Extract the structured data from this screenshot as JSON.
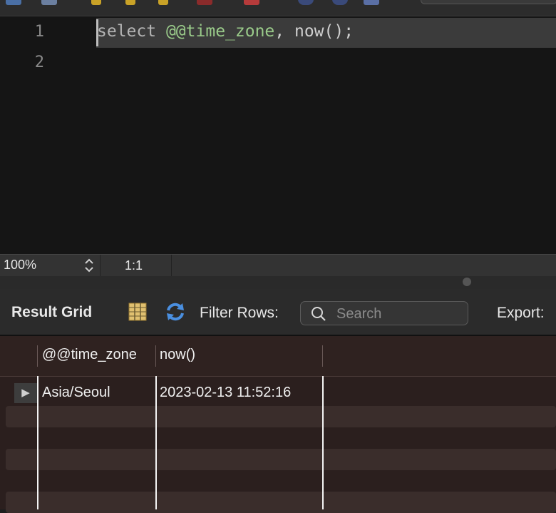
{
  "editor": {
    "lines": [
      "1",
      "2"
    ],
    "code": {
      "keyword": "select",
      "variable": "@@time_zone",
      "separator": ", ",
      "function": "now();"
    }
  },
  "status": {
    "zoom": "100%",
    "cursor_position": "1:1"
  },
  "result_toolbar": {
    "title": "Result Grid",
    "filter_label": "Filter Rows:",
    "search_placeholder": "Search",
    "export_label": "Export:"
  },
  "grid": {
    "columns": [
      "@@time_zone",
      "now()"
    ],
    "rows": [
      [
        "Asia/Seoul",
        "2023-02-13 11:52:16"
      ]
    ]
  },
  "icons": {
    "grid": "grid-layout-icon",
    "refresh": "refresh-icon",
    "search": "search-icon",
    "row_pointer": "row-pointer-icon"
  },
  "colors": {
    "editor_bg": "#151515",
    "keyword": "#b4b4b4",
    "variable": "#9acb8a",
    "grid_bg": "#2b1f1e",
    "refresh_blue": "#4a8fe0"
  }
}
